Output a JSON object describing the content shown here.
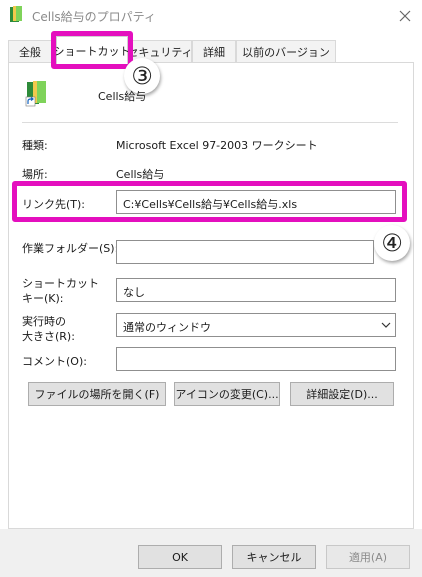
{
  "window": {
    "title": "Cells給与のプロパティ"
  },
  "tabs": [
    {
      "label": "全般"
    },
    {
      "label": "ショートカット"
    },
    {
      "label": "セキュリティ"
    },
    {
      "label": "詳細"
    },
    {
      "label": "以前のバージョン"
    }
  ],
  "shortcut": {
    "name": "Cells給与",
    "type_label": "種類:",
    "type_value": "Microsoft Excel 97-2003 ワークシート",
    "location_label": "場所:",
    "location_value": "Cells給与",
    "target_label": "リンク先(T):",
    "target_value": "C:¥Cells¥Cells給与¥Cells給与.xls",
    "start_in_label": "作業フォルダー(S):",
    "start_in_value": "",
    "hotkey_label_line1": "ショートカット",
    "hotkey_label_line2": "キー(K):",
    "hotkey_value": "なし",
    "run_label_line1": "実行時の",
    "run_label_line2": "大きさ(R):",
    "run_value": "通常のウィンドウ",
    "comment_label": "コメント(O):",
    "comment_value": "",
    "open_location_button": "ファイルの場所を開く(F)",
    "change_icon_button": "アイコンの変更(C)...",
    "advanced_button": "詳細設定(D)..."
  },
  "footer": {
    "ok": "OK",
    "cancel": "キャンセル",
    "apply": "適用(A)"
  },
  "annotations": {
    "marker3": "③",
    "marker4": "④",
    "highlight_color": "#e40fbe"
  }
}
